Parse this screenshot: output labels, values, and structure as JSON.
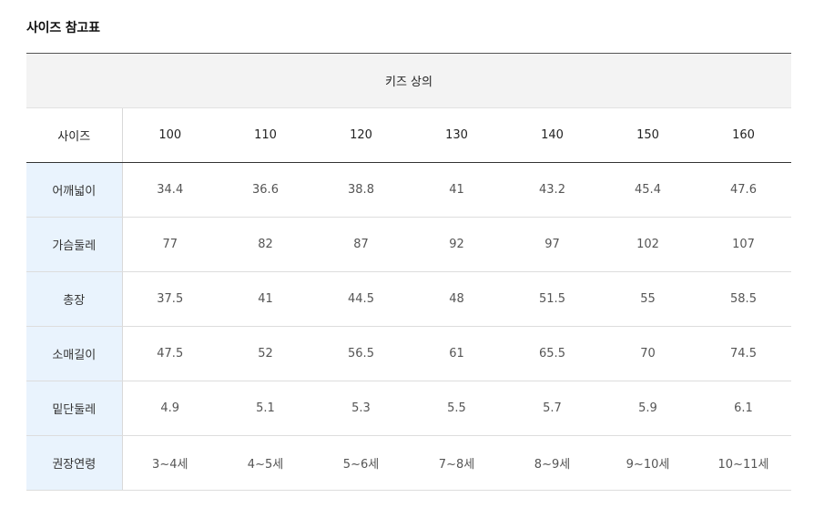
{
  "page": {
    "title": "사이즈 참고표"
  },
  "table": {
    "caption": "키즈 상의",
    "header_label": "사이즈",
    "sizes": [
      "100",
      "110",
      "120",
      "130",
      "140",
      "150",
      "160"
    ],
    "rows": [
      {
        "label": "어깨넓이",
        "values": [
          "34.4",
          "36.6",
          "38.8",
          "41",
          "43.2",
          "45.4",
          "47.6"
        ]
      },
      {
        "label": "가슴둘레",
        "values": [
          "77",
          "82",
          "87",
          "92",
          "97",
          "102",
          "107"
        ]
      },
      {
        "label": "총장",
        "values": [
          "37.5",
          "41",
          "44.5",
          "48",
          "51.5",
          "55",
          "58.5"
        ]
      },
      {
        "label": "소매길이",
        "values": [
          "47.5",
          "52",
          "56.5",
          "61",
          "65.5",
          "70",
          "74.5"
        ]
      },
      {
        "label": "밑단둘레",
        "values": [
          "4.9",
          "5.1",
          "5.3",
          "5.5",
          "5.7",
          "5.9",
          "6.1"
        ]
      },
      {
        "label": "권장연령",
        "values": [
          "3~4세",
          "4~5세",
          "5~6세",
          "7~8세",
          "8~9세",
          "9~10세",
          "10~11세"
        ]
      }
    ]
  },
  "colors": {
    "label_column_bg": "#e9f3fd",
    "caption_bg": "#f3f3f3",
    "border": "#dddddd",
    "header_rule": "#333333"
  }
}
